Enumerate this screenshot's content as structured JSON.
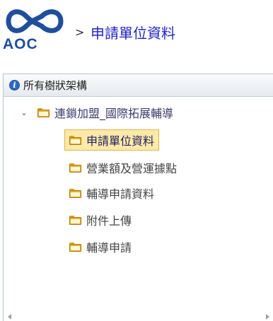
{
  "header": {
    "logo_text": "AOC",
    "crumb_separator": ">",
    "crumb_current": "申請單位資料"
  },
  "panel": {
    "title": "所有樹狀架構"
  },
  "tree": {
    "root": {
      "label": "連鎖加盟_國際拓展輔導",
      "expanded": true
    },
    "children": [
      {
        "label": "申請單位資料",
        "selected": true
      },
      {
        "label": "營業額及營運據點",
        "selected": false
      },
      {
        "label": "輔導申請資料",
        "selected": false
      },
      {
        "label": "附件上傳",
        "selected": false
      },
      {
        "label": "輔導申請",
        "selected": false
      }
    ]
  },
  "colors": {
    "brand": "#1f4e9c",
    "breadcrumb": "#2323c8",
    "selection": "#fde9a8",
    "folder": "#e8b32c"
  },
  "icons": {
    "logo": "aoc-logo-icon",
    "info": "info-icon",
    "toggle": "chevron-down-icon",
    "folder": "folder-icon",
    "scroll_left": "arrow-left-icon",
    "scroll_right": "arrow-right-icon"
  }
}
